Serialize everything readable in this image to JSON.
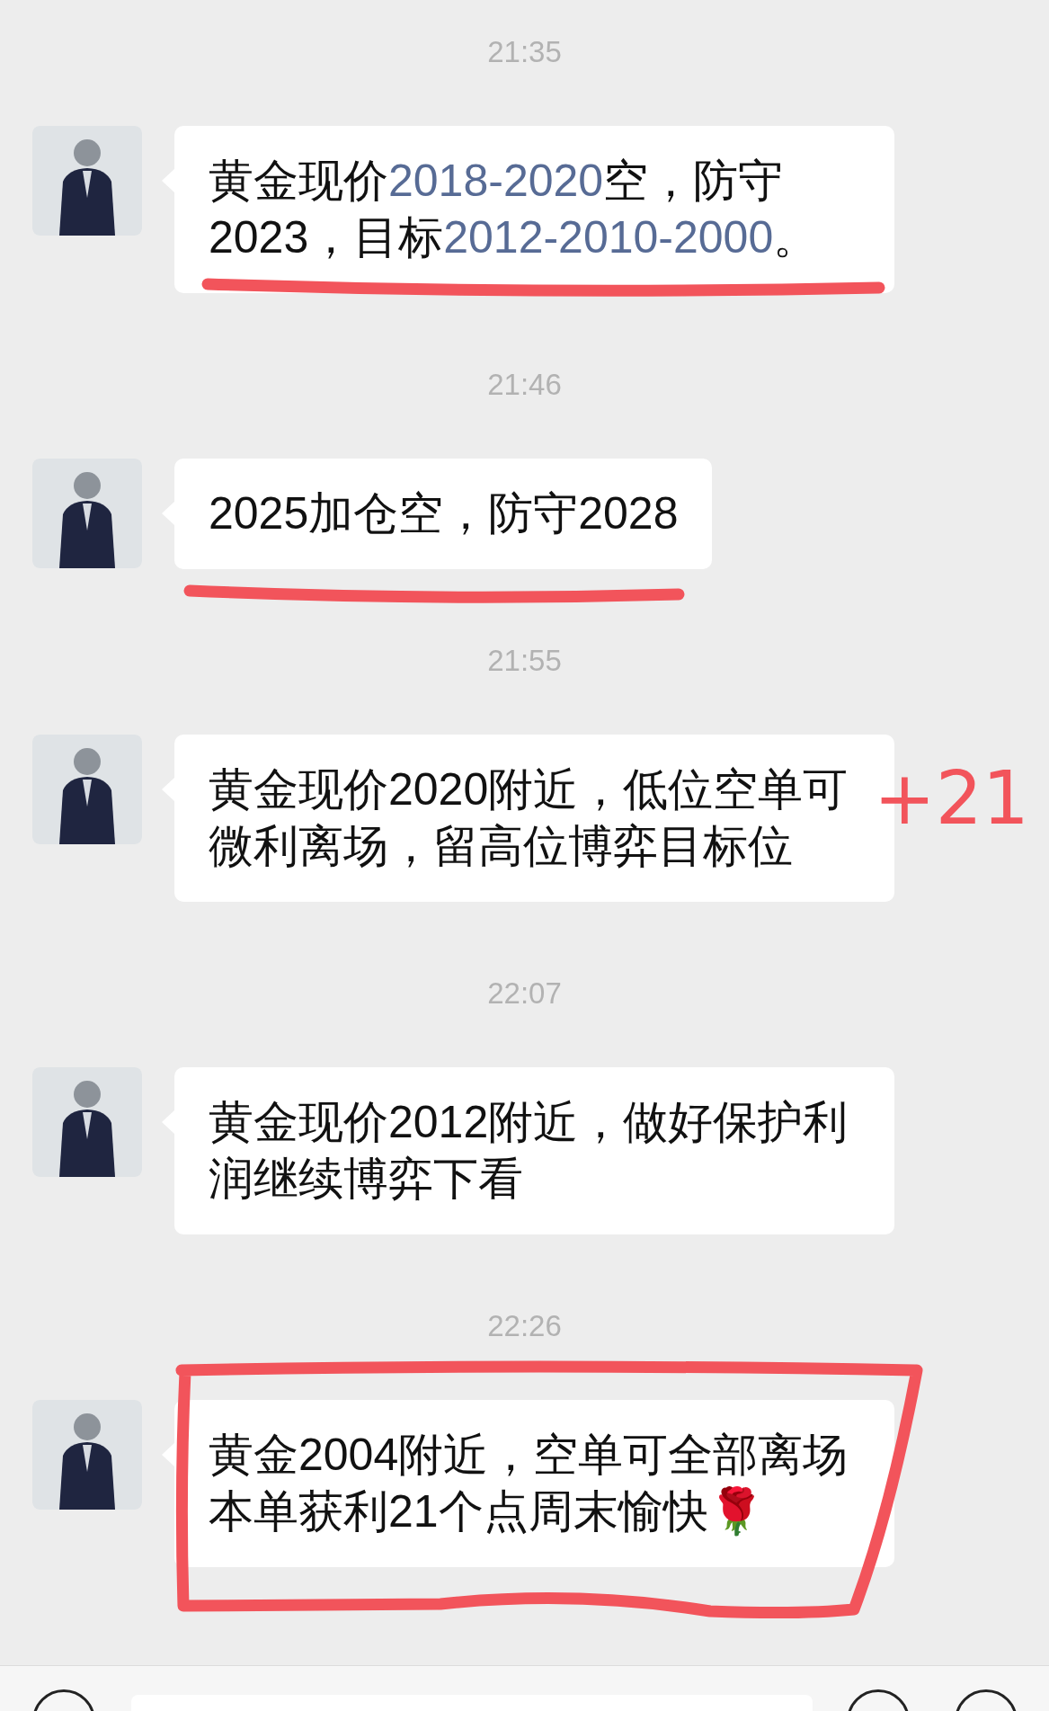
{
  "messages": [
    {
      "time": "21:35",
      "parts": [
        {
          "kind": "text",
          "text": "黄金现价"
        },
        {
          "kind": "link",
          "text": "2018-2020"
        },
        {
          "kind": "text",
          "text": "空，防守2023，目标"
        },
        {
          "kind": "link",
          "text": "2012-2010-2000"
        },
        {
          "kind": "text",
          "text": "。"
        }
      ],
      "underlined": true,
      "boxed": false
    },
    {
      "time": "21:46",
      "parts": [
        {
          "kind": "text",
          "text": "2025加仓空，防守2028"
        }
      ],
      "underlined": true,
      "boxed": false
    },
    {
      "time": "21:55",
      "parts": [
        {
          "kind": "text",
          "text": "黄金现价2020附近，低位空单可微利离场，留高位博弈目标位"
        }
      ],
      "underlined": false,
      "boxed": false,
      "handwriting": "+21"
    },
    {
      "time": "22:07",
      "parts": [
        {
          "kind": "text",
          "text": "黄金现价2012附近，做好保护利润继续博弈下看"
        }
      ],
      "underlined": false,
      "boxed": false
    },
    {
      "time": "22:26",
      "parts": [
        {
          "kind": "text",
          "text": "黄金2004附近，空单可全部离场本单获利21个点周末愉快🌹"
        }
      ],
      "underlined": false,
      "boxed": true
    }
  ]
}
